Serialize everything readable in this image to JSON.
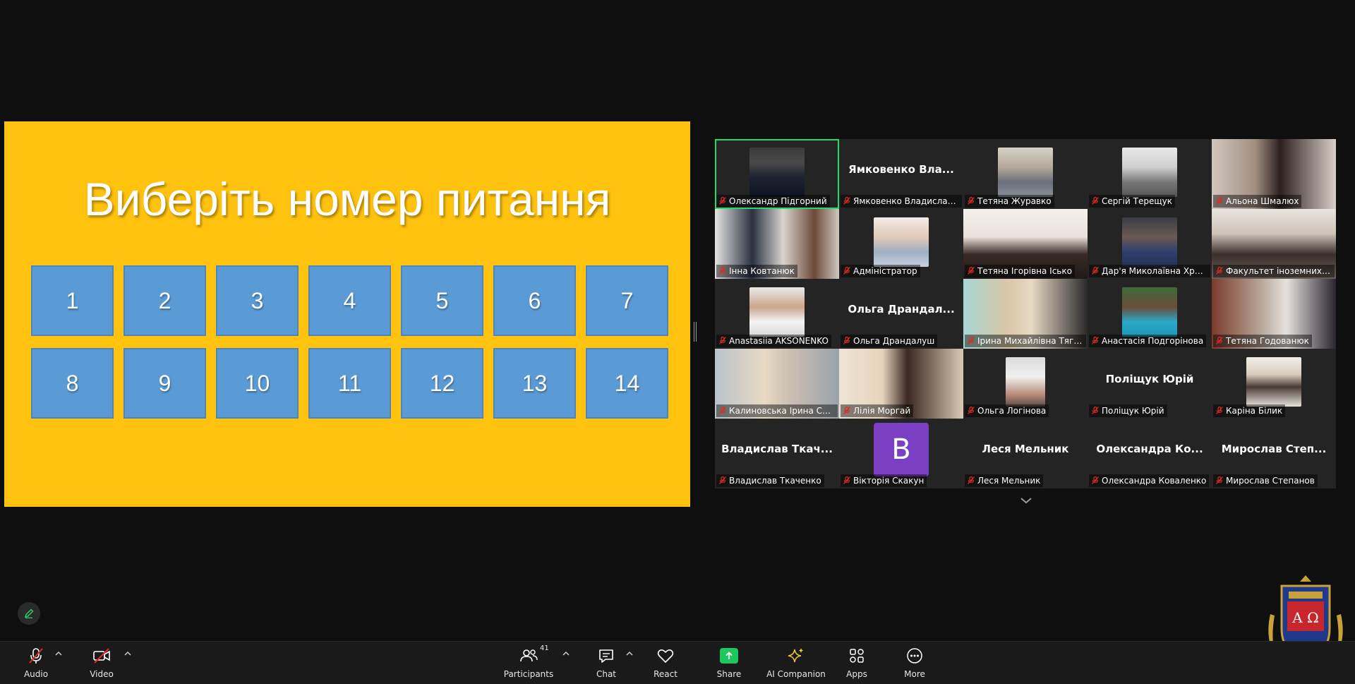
{
  "slide": {
    "title": "Виберіть номер питання",
    "numbers": [
      "1",
      "2",
      "3",
      "4",
      "5",
      "6",
      "7",
      "8",
      "9",
      "10",
      "11",
      "12",
      "13",
      "14"
    ],
    "background_color": "#FFC20E",
    "box_color": "#5B9BD5"
  },
  "gallery": {
    "tiles": [
      {
        "name": "Олександр Підгорний"
      },
      {
        "name": "Ямковенко Владислав ...",
        "display": "Ямковенко Вла..."
      },
      {
        "name": "Тетяна Журавко"
      },
      {
        "name": "Сергій Терещук"
      },
      {
        "name": "Альона Шмалюх"
      },
      {
        "name": "Інна Ковтанюк"
      },
      {
        "name": "Адміністратор"
      },
      {
        "name": "Тетяна Ігорівна Ісько"
      },
      {
        "name": "Дар'я Миколаївна Хри..."
      },
      {
        "name": "Факультет іноземних мов"
      },
      {
        "name": "Anastasiia AKSONENKO"
      },
      {
        "name": "Ольга Драндалуш",
        "display": "Ольга Драндал..."
      },
      {
        "name": "Ірина Михайлівна Тягай"
      },
      {
        "name": "Анастасія Подгорінова"
      },
      {
        "name": "Тетяна Годованюк"
      },
      {
        "name": "Калиновська Ірина Сер..."
      },
      {
        "name": "Лілія Моргай"
      },
      {
        "name": "Ольга Логінова"
      },
      {
        "name": "Поліщук Юрій",
        "display": "Поліщук Юрій"
      },
      {
        "name": "Каріна Білик"
      },
      {
        "name": "Владислав Ткаченко",
        "display": "Владислав Ткач..."
      },
      {
        "name": "Вікторія Скакун",
        "avatar_letter": "B"
      },
      {
        "name": "Леся Мельник",
        "display": "Леся Мельник"
      },
      {
        "name": "Олександра Коваленко",
        "display": "Олександра Ко..."
      },
      {
        "name": "Мирослав Степанов",
        "display": "Мирослав Степ..."
      }
    ]
  },
  "toolbar": {
    "audio_label": "Audio",
    "video_label": "Video",
    "participants_label": "Participants",
    "participants_count": "41",
    "chat_label": "Chat",
    "react_label": "React",
    "share_label": "Share",
    "ai_label": "AI Companion",
    "apps_label": "Apps",
    "more_label": "More"
  },
  "logo": {
    "letters": "A Ω"
  },
  "colors": {
    "accent_green": "#23d96a",
    "share_green": "#1ec85f",
    "mute_red": "#e02828"
  }
}
